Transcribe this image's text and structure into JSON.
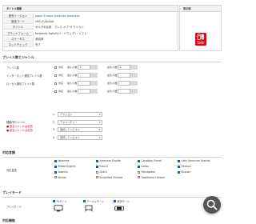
{
  "info": {
    "header": "タイトル情報",
    "rows": [
      {
        "label": "発売リージョン",
        "value": "Japan Europe Australia Americas",
        "style": "blue"
      },
      {
        "label": "製品コード",
        "value": "HAC-P-AAAAA",
        "style": ""
      },
      {
        "label": "タイトル",
        "value": "ゼルダの伝説　ブレス オブ ザ ワイルド",
        "style": ""
      },
      {
        "label": "プラットフォーム",
        "value": "Nintendo Switch(ハードウェア)・ソフト",
        "style": ""
      },
      {
        "label": "ステータス",
        "value": "承認済",
        "style": ""
      },
      {
        "label": "ロットチェック",
        "value": "完了",
        "style": ""
      }
    ]
  },
  "display": {
    "header": "表示部",
    "logo_text": "Nintendo SWITCH",
    "brand_color": "#e60012"
  },
  "players": {
    "section_title": "プレイ人数とジャンル",
    "rows": [
      {
        "label": "プレイ人数",
        "cb_label": "対応",
        "min_label": "最小人数",
        "min": "1",
        "max_label": "最大人数",
        "max": "1"
      },
      {
        "label": "インターネット通信プレイ人数",
        "cb_label": "対応",
        "min_label": "最小人数",
        "min": "",
        "max_label": "最大人数",
        "max": ""
      },
      {
        "label": "ローカル通信プレイ人数",
        "cb_label": "対応",
        "min_label": "最小人数",
        "min": "",
        "max_label": "最大人数",
        "max": ""
      },
      {
        "label": "",
        "cb_label": "対応",
        "min_label": "最小人数",
        "min": "",
        "max_label": "最大人数",
        "max": ""
      }
    ]
  },
  "genre": {
    "label": "種類/別ジャンル",
    "notes": [
      "■ 複合ジャンルは必須",
      "■ 複合ジャンルは必須"
    ],
    "items": [
      {
        "num": "1.",
        "value": "アクション"
      },
      {
        "num": "2.",
        "value": "アドベンチャー"
      },
      {
        "num": "3.",
        "value": "選択してください"
      },
      {
        "num": "4.",
        "value": "選択してください"
      }
    ]
  },
  "languages": {
    "section_title": "対応言語",
    "label": "対応言語",
    "items": [
      {
        "name": "Japanese",
        "checked": true
      },
      {
        "name": "American English",
        "checked": true
      },
      {
        "name": "Canadian French",
        "checked": true
      },
      {
        "name": "Latin American Spanish",
        "checked": true
      },
      {
        "name": "British English",
        "checked": true
      },
      {
        "name": "French",
        "checked": true
      },
      {
        "name": "Italian",
        "checked": true
      },
      {
        "name": "German",
        "checked": true
      },
      {
        "name": "Spanish",
        "checked": true
      },
      {
        "name": "Dutch",
        "checked": false
      },
      {
        "name": "Portuguese",
        "checked": false
      },
      {
        "name": "Russian",
        "checked": true
      },
      {
        "name": "Korean",
        "checked": false
      },
      {
        "name": "Simplified Chinese",
        "checked": false
      },
      {
        "name": "Traditional Chinese",
        "checked": false
      }
    ]
  },
  "playmodes": {
    "section_title": "プレイモード",
    "label": "プレイモード",
    "items": [
      {
        "name": "TVモード",
        "checked": true,
        "icon": "tv-mode-icon"
      },
      {
        "name": "テーブルモード",
        "checked": true,
        "icon": "tabletop-mode-icon"
      },
      {
        "name": "携帯モード",
        "checked": true,
        "icon": "handheld-mode-icon"
      }
    ]
  },
  "next_section": {
    "section_title": "対応機能"
  },
  "search_fab": {
    "icon": "magnifier-icon",
    "bg": "#555555"
  }
}
